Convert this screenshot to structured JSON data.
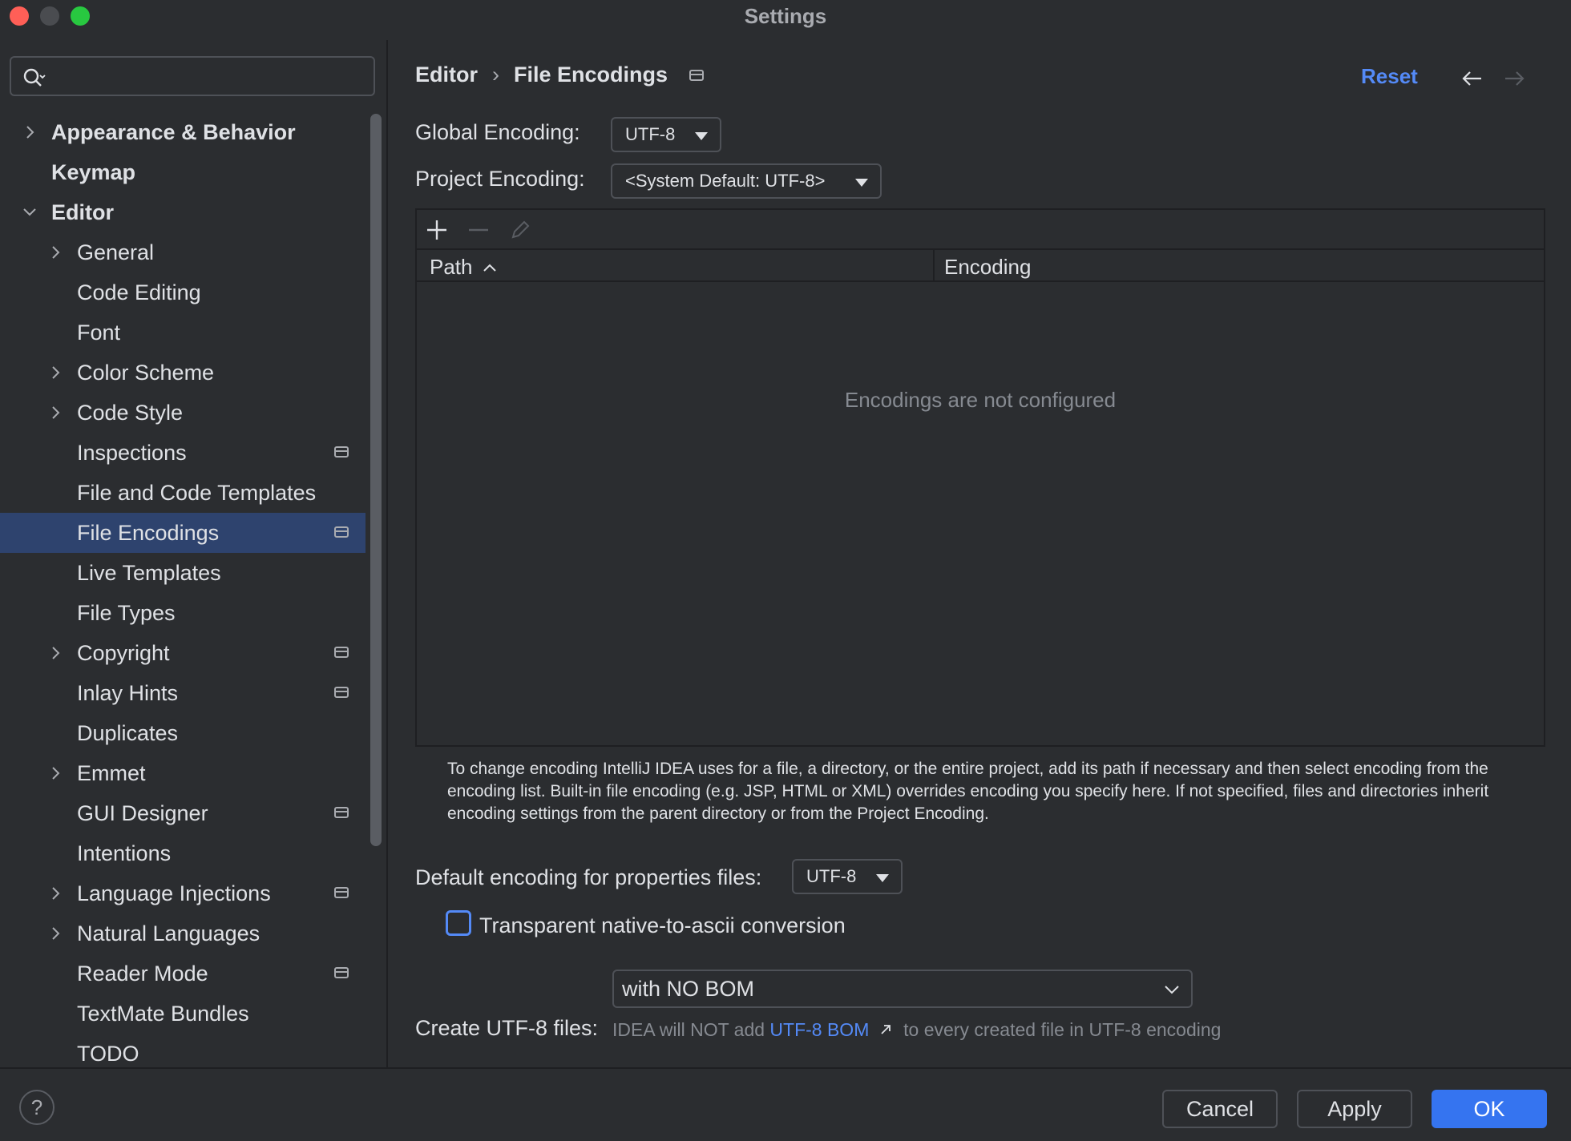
{
  "window": {
    "title": "Settings"
  },
  "search": {
    "placeholder": ""
  },
  "sidebar": {
    "items": [
      {
        "label": "Appearance & Behavior",
        "level": 0,
        "bold": true,
        "chevron": "right",
        "badge": false,
        "selected": false
      },
      {
        "label": "Keymap",
        "level": 0,
        "bold": true,
        "chevron": "none",
        "badge": false,
        "selected": false
      },
      {
        "label": "Editor",
        "level": 0,
        "bold": true,
        "chevron": "down",
        "badge": false,
        "selected": false
      },
      {
        "label": "General",
        "level": 1,
        "bold": false,
        "chevron": "right",
        "badge": false,
        "selected": false
      },
      {
        "label": "Code Editing",
        "level": 1,
        "bold": false,
        "chevron": "none",
        "badge": false,
        "selected": false
      },
      {
        "label": "Font",
        "level": 1,
        "bold": false,
        "chevron": "none",
        "badge": false,
        "selected": false
      },
      {
        "label": "Color Scheme",
        "level": 1,
        "bold": false,
        "chevron": "right",
        "badge": false,
        "selected": false
      },
      {
        "label": "Code Style",
        "level": 1,
        "bold": false,
        "chevron": "right",
        "badge": false,
        "selected": false
      },
      {
        "label": "Inspections",
        "level": 1,
        "bold": false,
        "chevron": "none",
        "badge": true,
        "selected": false
      },
      {
        "label": "File and Code Templates",
        "level": 1,
        "bold": false,
        "chevron": "none",
        "badge": false,
        "selected": false
      },
      {
        "label": "File Encodings",
        "level": 1,
        "bold": false,
        "chevron": "none",
        "badge": true,
        "selected": true
      },
      {
        "label": "Live Templates",
        "level": 1,
        "bold": false,
        "chevron": "none",
        "badge": false,
        "selected": false
      },
      {
        "label": "File Types",
        "level": 1,
        "bold": false,
        "chevron": "none",
        "badge": false,
        "selected": false
      },
      {
        "label": "Copyright",
        "level": 1,
        "bold": false,
        "chevron": "right",
        "badge": true,
        "selected": false
      },
      {
        "label": "Inlay Hints",
        "level": 1,
        "bold": false,
        "chevron": "none",
        "badge": true,
        "selected": false
      },
      {
        "label": "Duplicates",
        "level": 1,
        "bold": false,
        "chevron": "none",
        "badge": false,
        "selected": false
      },
      {
        "label": "Emmet",
        "level": 1,
        "bold": false,
        "chevron": "right",
        "badge": false,
        "selected": false
      },
      {
        "label": "GUI Designer",
        "level": 1,
        "bold": false,
        "chevron": "none",
        "badge": true,
        "selected": false
      },
      {
        "label": "Intentions",
        "level": 1,
        "bold": false,
        "chevron": "none",
        "badge": false,
        "selected": false
      },
      {
        "label": "Language Injections",
        "level": 1,
        "bold": false,
        "chevron": "right",
        "badge": true,
        "selected": false
      },
      {
        "label": "Natural Languages",
        "level": 1,
        "bold": false,
        "chevron": "right",
        "badge": false,
        "selected": false
      },
      {
        "label": "Reader Mode",
        "level": 1,
        "bold": false,
        "chevron": "none",
        "badge": true,
        "selected": false
      },
      {
        "label": "TextMate Bundles",
        "level": 1,
        "bold": false,
        "chevron": "none",
        "badge": false,
        "selected": false
      },
      {
        "label": "TODO",
        "level": 1,
        "bold": false,
        "chevron": "none",
        "badge": false,
        "selected": false
      }
    ]
  },
  "breadcrumb": {
    "parent": "Editor",
    "separator": "›",
    "current": "File Encodings"
  },
  "header": {
    "reset_label": "Reset"
  },
  "encoding": {
    "global_label": "Global Encoding:",
    "global_value": "UTF-8",
    "project_label": "Project Encoding:",
    "project_value": "<System Default: UTF-8>"
  },
  "table": {
    "columns": [
      "Path",
      "Encoding"
    ],
    "empty_text": "Encodings are not configured"
  },
  "help_text": "To change encoding IntelliJ IDEA uses for a file, a directory, or the entire project, add its path if necessary and then select encoding from the encoding list. Built-in file encoding (e.g. JSP, HTML or XML) overrides encoding you specify here. If not specified, files and directories inherit encoding settings from the parent directory or from the Project Encoding.",
  "properties": {
    "label": "Default encoding for properties files:",
    "value": "UTF-8",
    "checkbox_label": "Transparent native-to-ascii conversion",
    "checkbox_checked": false
  },
  "bom": {
    "label": "Create UTF-8 files:",
    "value": "with NO BOM",
    "hint_prefix": "IDEA will NOT add",
    "hint_link": "UTF-8 BOM",
    "hint_suffix": "to every created file in UTF-8 encoding"
  },
  "footer": {
    "help_label": "?",
    "cancel_label": "Cancel",
    "apply_label": "Apply",
    "ok_label": "OK"
  },
  "colors": {
    "background": "#2b2d30",
    "selection": "#2e436e",
    "accent": "#548af7",
    "primary_button": "#3574f0"
  }
}
